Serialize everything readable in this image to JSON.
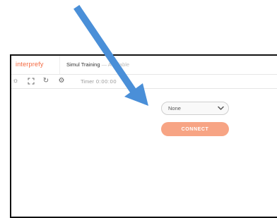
{
  "app": {
    "logo_text": "interprefy"
  },
  "tab": {
    "title": "Simul Training",
    "status": " — Available"
  },
  "toolbar": {
    "icons": [
      "brightness-icon",
      "fullscreen-icon",
      "refresh-icon",
      "settings-icon"
    ],
    "timer_label": "Timer",
    "timer_value": "0:00:00"
  },
  "channel_select": {
    "value": "None"
  },
  "connect_button": {
    "label": "CONNECT"
  },
  "colors": {
    "brand": "#f3673e",
    "connect_button": "#f7a484",
    "annotation_arrow": "#4a8fd8"
  }
}
